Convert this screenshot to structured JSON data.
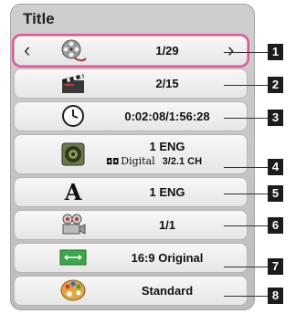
{
  "title": "Title",
  "rows": [
    {
      "id": "title-number",
      "icon": "film-reel-icon",
      "value": "1/29",
      "badge": "1",
      "selected": true
    },
    {
      "id": "chapter",
      "icon": "clapperboard-icon",
      "value": "2/15",
      "badge": "2"
    },
    {
      "id": "time",
      "icon": "clock-icon",
      "value": "0:02:08/1:56:28",
      "badge": "3"
    },
    {
      "id": "audio",
      "icon": "speaker-icon",
      "value": "1 ENG",
      "sub_format": "Digital",
      "sub_channels": "3/2.1 CH",
      "badge": "4"
    },
    {
      "id": "subtitle",
      "icon": "subtitle-a-icon",
      "value": "1 ENG",
      "badge": "5"
    },
    {
      "id": "angle",
      "icon": "camera-icon",
      "value": "1/1",
      "badge": "6"
    },
    {
      "id": "picture-ratio",
      "icon": "aspect-ratio-icon",
      "value": "16:9 Original",
      "badge": "7"
    },
    {
      "id": "picture-mode",
      "icon": "palette-icon",
      "value": "Standard",
      "badge": "8"
    }
  ],
  "arrows": {
    "left": "‹",
    "right": "›"
  },
  "colors": {
    "selection": "#e8509a",
    "badge": "#1c1c1c"
  }
}
